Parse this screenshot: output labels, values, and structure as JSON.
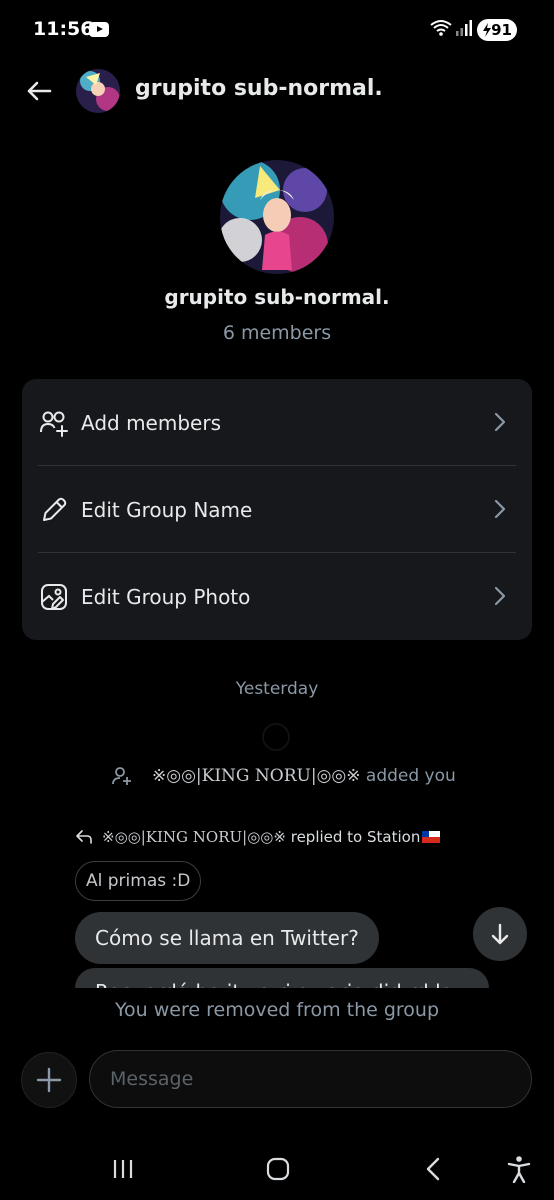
{
  "status_bar": {
    "time": "11:56",
    "battery": "91"
  },
  "header": {
    "title": "grupito sub-normal."
  },
  "profile": {
    "name": "grupito sub-normal.",
    "members": "6 members"
  },
  "actions": [
    {
      "label": "Add members"
    },
    {
      "label": "Edit Group Name"
    },
    {
      "label": "Edit Group Photo"
    }
  ],
  "messages": {
    "date_separator": "Yesterday",
    "added_event": {
      "actor": "※◎◎|KING NORU|◎◎※",
      "text": " added you"
    },
    "reply_event": {
      "actor": "※◎◎|KING NORU|◎◎※",
      "text": " replied to Station"
    },
    "quoted_text": "Al primas :D",
    "bubble_text": "Cómo se llama en Twitter?",
    "bubble_text_2": "Recuerdá ba it ya ri a zaria did rd la"
  },
  "notice": "You were removed from the group",
  "composer": {
    "placeholder": "Message"
  },
  "colors": {
    "background": "#000000",
    "card": "#16181c",
    "secondary_text": "#8b98a5",
    "bubble": "#2f3336"
  }
}
